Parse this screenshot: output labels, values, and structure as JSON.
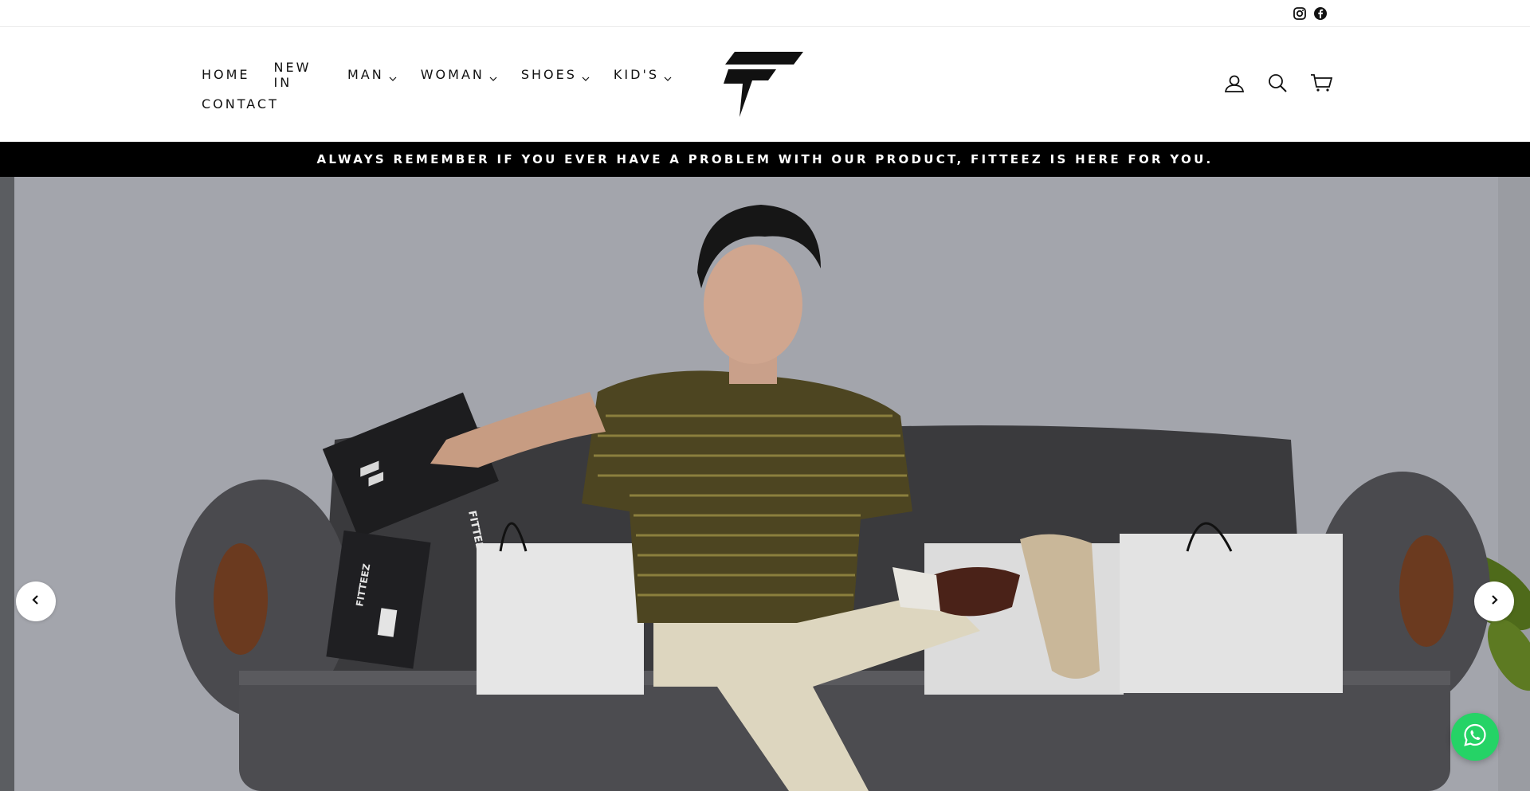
{
  "utility": {
    "icons": [
      "instagram-icon",
      "facebook-icon"
    ]
  },
  "nav": {
    "items": [
      {
        "label": "HOME",
        "dropdown": false
      },
      {
        "label": "NEW IN",
        "dropdown": false
      },
      {
        "label": "MAN",
        "dropdown": true
      },
      {
        "label": "WOMAN",
        "dropdown": true
      },
      {
        "label": "SHOES",
        "dropdown": true
      },
      {
        "label": "KID'S",
        "dropdown": true
      },
      {
        "label": "CONTACT",
        "dropdown": false
      }
    ]
  },
  "header": {
    "icons": [
      "account-icon",
      "search-icon",
      "cart-icon"
    ]
  },
  "announcement": {
    "text": "ALWAYS REMEMBER IF YOU EVER HAVE A PROBLEM WITH OUR PRODUCT, FITTEEZ IS HERE FOR YOU."
  },
  "hero": {
    "box_print": "FITTEEZ",
    "controls": [
      "chevron-left-icon",
      "chevron-right-icon",
      "whatsapp-icon"
    ]
  },
  "colors": {
    "brand_black": "#000000",
    "whatsapp_green": "#25d366",
    "hero_background": "#a2a4ab"
  }
}
